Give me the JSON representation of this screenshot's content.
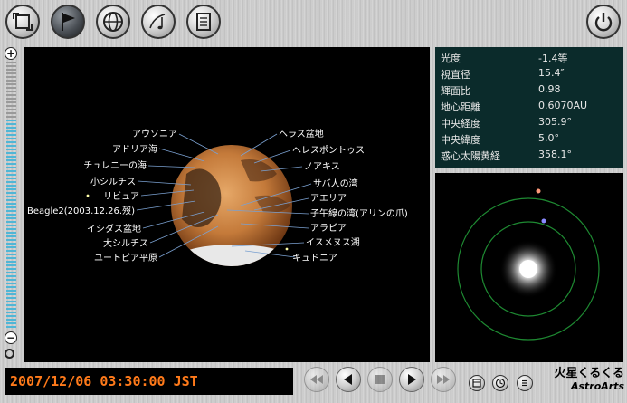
{
  "toolbar": {
    "buttons": [
      {
        "name": "rotate-view-button",
        "icon": "rotate-icon"
      },
      {
        "name": "flag-button",
        "icon": "flag-icon"
      },
      {
        "name": "globe-button",
        "icon": "globe-icon"
      },
      {
        "name": "music-button",
        "icon": "music-note-icon"
      },
      {
        "name": "notes-button",
        "icon": "notepad-icon"
      }
    ],
    "power_icon": "power-icon"
  },
  "features": {
    "left": [
      "アウソニア",
      "アドリア海",
      "チュレニーの海",
      "小シルチス",
      "リビュア",
      "Beagle2(2003.12.26.歿)",
      "イシダス盆地",
      "大シルチス",
      "ユートピア平原"
    ],
    "right": [
      "ヘラス盆地",
      "ヘレスポントゥス",
      "ノアキス",
      "サバ人の湾",
      "アエリア",
      "子午線の湾(アリンの爪)",
      "アラビア",
      "イスメヌス湖",
      "キュドニア"
    ]
  },
  "info": [
    {
      "label": "光度",
      "value": "-1.4等"
    },
    {
      "label": "視直径",
      "value": "15.4″"
    },
    {
      "label": "輝面比",
      "value": "0.98"
    },
    {
      "label": "地心距離",
      "value": "0.6070AU"
    },
    {
      "label": "中央経度",
      "value": "305.9°"
    },
    {
      "label": "中央緯度",
      "value": "5.0°"
    },
    {
      "label": "惑心太陽黄経",
      "value": "358.1°"
    }
  ],
  "datetime": "2007/12/06 03:30:00 JST",
  "brand": {
    "title": "火星くるくる",
    "company": "AstroArts"
  },
  "colors": {
    "accent": "#ff7a1a",
    "zoom_active": "#4fb6d6",
    "orbit": "#1e8a32"
  }
}
